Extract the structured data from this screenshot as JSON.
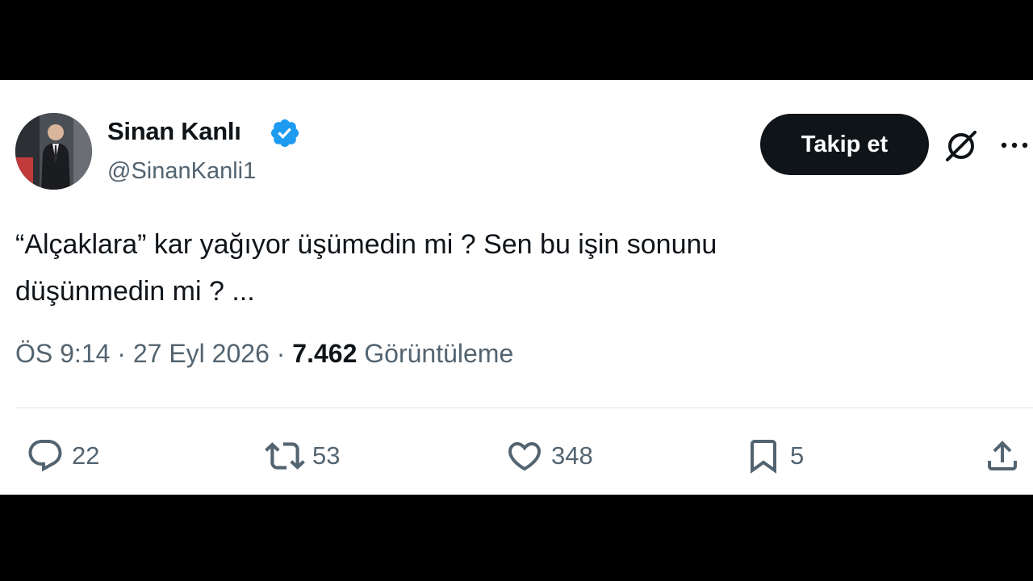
{
  "tweet": {
    "author": {
      "display_name": "Sinan Kanlı",
      "handle": "@SinanKanli1",
      "verified": true
    },
    "follow_label": "Takip et",
    "text_line1": "“Alçaklara” kar yağıyor üşümedin mi ? Sen bu işin sonunu",
    "text_line2": "düşünmedin mi ? ...",
    "time": "ÖS 9:14",
    "separator": "·",
    "date": "27 Eyl 2026",
    "views_count": "7.462",
    "views_label": "Görüntüleme",
    "actions": {
      "replies": "22",
      "reposts": "53",
      "likes": "348",
      "bookmarks": "5"
    }
  },
  "colors": {
    "primary_text": "#0f1419",
    "secondary_text": "#536471",
    "verified_badge": "#1d9bf0",
    "follow_button_bg": "#0f1419",
    "letterbox": "#000000"
  },
  "icons": [
    "verified-badge-icon",
    "grok-icon",
    "more-icon",
    "reply-icon",
    "repost-icon",
    "like-icon",
    "bookmark-icon",
    "share-icon"
  ]
}
